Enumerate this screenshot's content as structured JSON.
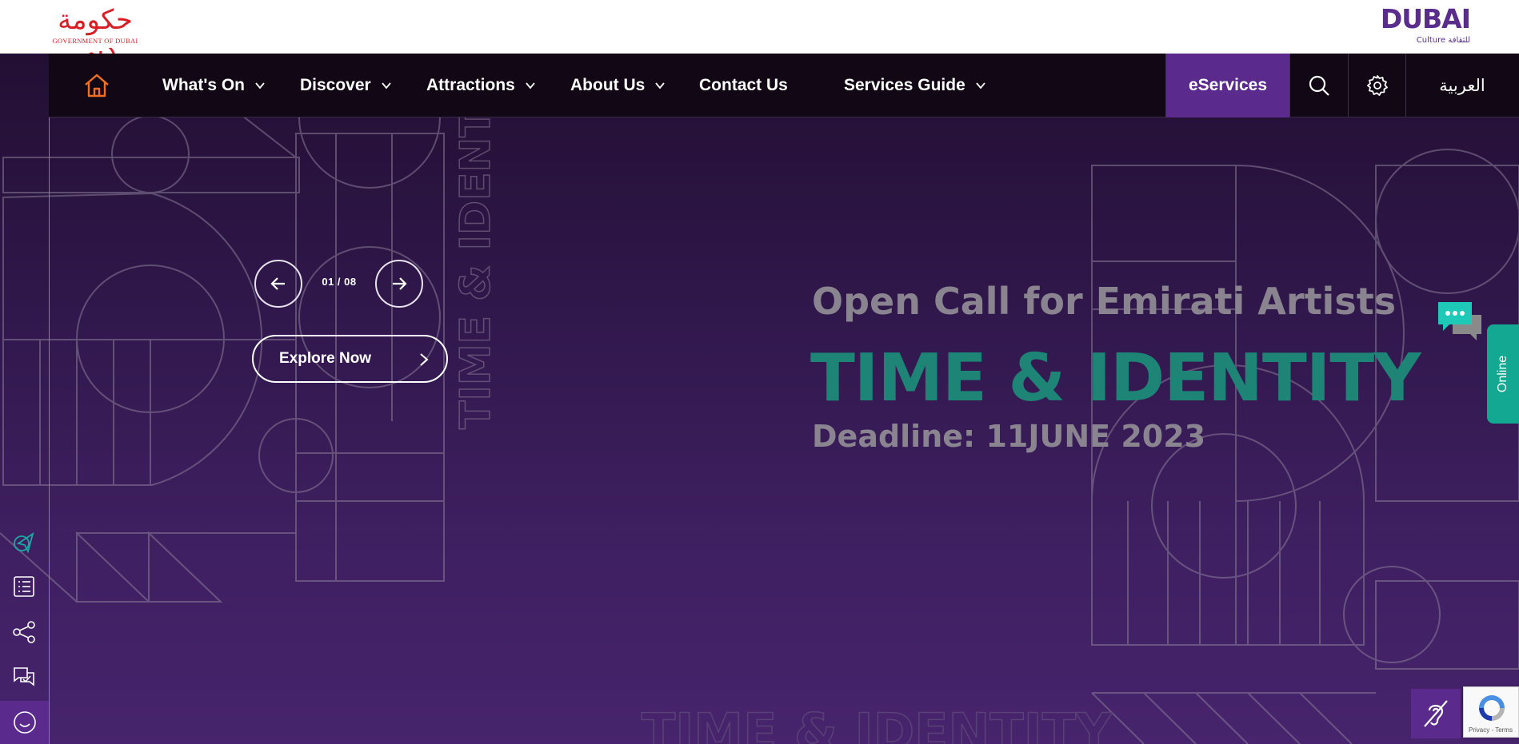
{
  "header": {
    "gov_logo_ar": "حكومة دبي",
    "gov_logo_en": "GOVERNMENT OF DUBAI",
    "brand_word": "DUBAI",
    "brand_sub": "Culture للثقافة"
  },
  "nav": {
    "items": [
      {
        "label": "What's On",
        "has_dropdown": true
      },
      {
        "label": "Discover",
        "has_dropdown": true
      },
      {
        "label": "Attractions",
        "has_dropdown": true
      },
      {
        "label": "About Us",
        "has_dropdown": true
      },
      {
        "label": "Contact Us",
        "has_dropdown": false
      },
      {
        "label": "Services Guide",
        "has_dropdown": true
      }
    ],
    "eservices": "eServices",
    "language": "العربية"
  },
  "slider": {
    "counter": "01 / 08",
    "cta": "Explore Now"
  },
  "hero": {
    "subtitle": "Open Call for Emirati Artists",
    "title": "TIME & IDENTITY",
    "deadline": "Deadline: 11JUNE 2023",
    "watermark": "TIME & IDENTITY"
  },
  "widgets": {
    "online_label": "Online",
    "recaptcha_terms": "Privacy - Terms"
  },
  "colors": {
    "brand_purple": "#5b2a8d",
    "hero_teal": "#1d8476",
    "online_green": "#13a891",
    "home_orange": "#f26f21",
    "gov_red": "#d81f26"
  }
}
